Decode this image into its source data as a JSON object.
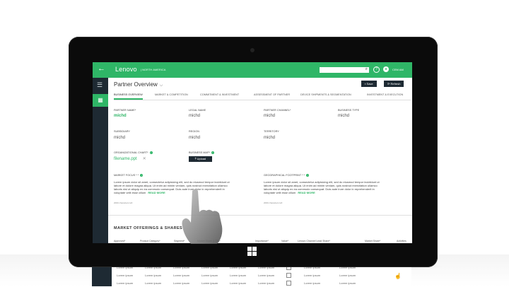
{
  "app": {
    "brand": "Lenovo",
    "region": "NORTH AMERICA",
    "search_placeholder": "",
    "search_icon": "search-icon",
    "help_icon": "help-icon",
    "user_initial": "●",
    "user_name": "CEM AM",
    "accent_color": "#2fb667",
    "dark_color": "#1e2a33"
  },
  "page": {
    "title": "Partner Overview",
    "save_label": "Save",
    "refresh_label": "Refresh"
  },
  "tabs": [
    {
      "label": "BUSINESS OVERVIEW"
    },
    {
      "label": "MARKET & COMPETITION"
    },
    {
      "label": "COMMITMENT & INVESTMENT"
    },
    {
      "label": "ASSESSMENT OF PARTNER"
    },
    {
      "label": "DEVICE SHIPMENTS & SEGMENTATION"
    },
    {
      "label": "INVESTMENT & EXECUTION"
    }
  ],
  "fields": {
    "partner_name_label": "PARTNER NAME*",
    "partner_name": "michd",
    "legal_name_label": "LEGAL NAME",
    "legal_name": "michd",
    "partner_channel_label": "PARTNER CHANNEL*",
    "partner_channel": "michd",
    "business_type_label": "BUSINESS TYPE",
    "business_type": "michd",
    "subsidiary_label": "SUBSIDIARY",
    "subsidiary": "michd",
    "region_label": "REGION",
    "region": "michd",
    "territory_label": "TERRITORY",
    "territory": "michd",
    "org_chart_label": "ORGANIZATIONAL CHART*",
    "org_chart_file": "filename.ppt",
    "business_map_label": "BUSINESS MAP*",
    "upload_label": "Upload",
    "market_focus_label": "MARKET FOCUS * *",
    "geo_footprint_label": "GEOGRAPHICAL FOOTPRINT * *",
    "lorem": "Lorem ipsum dolor sit amet, consectetur adipisicing elit, sed do eiusmod tempor incididunt ut labore et dolore magna aliqua. Ut enim ad minim veniam, quis nostrud exercitation ullamco laboris nisi ut aliquip ex ea commodo consequat. Duis aute irure dolor in reprehenderit in voluptate velit esse cillum",
    "read_more": "READ MORE",
    "chars_left": "2000 characters left"
  },
  "section": {
    "title": "MARKET OFFERINGS & SHARES",
    "columns": [
      "Approved*",
      "Product Category*",
      "Segment*",
      "Market Share (LOB)*",
      "Importance*",
      "Value*",
      "Lenovo Channel Lead Share*",
      "Market Share*",
      "Activities"
    ]
  },
  "table_rows": [
    [
      "Lorem ipsum",
      "Lorem ipsum",
      "Lorem ipsum",
      "Lorem ipsum",
      "Lorem ipsum",
      "Lorem ipsum",
      "Lorem ipsum",
      "Lorem ipsum",
      "Lorem ipsum"
    ],
    [
      "Lorem ipsum",
      "Lorem ipsum",
      "Lorem ipsum",
      "Lorem ipsum",
      "Lorem ipsum",
      "Lorem ipsum",
      "Lorem ipsum",
      "Lorem ipsum",
      "Lorem ipsum"
    ],
    [
      "Lorem ipsum",
      "Lorem ipsum",
      "Lorem ipsum",
      "Lorem ipsum",
      "Lorem ipsum",
      "Lorem ipsum",
      "Lorem ipsum",
      "Lorem ipsum",
      "Lorem ipsum"
    ]
  ]
}
